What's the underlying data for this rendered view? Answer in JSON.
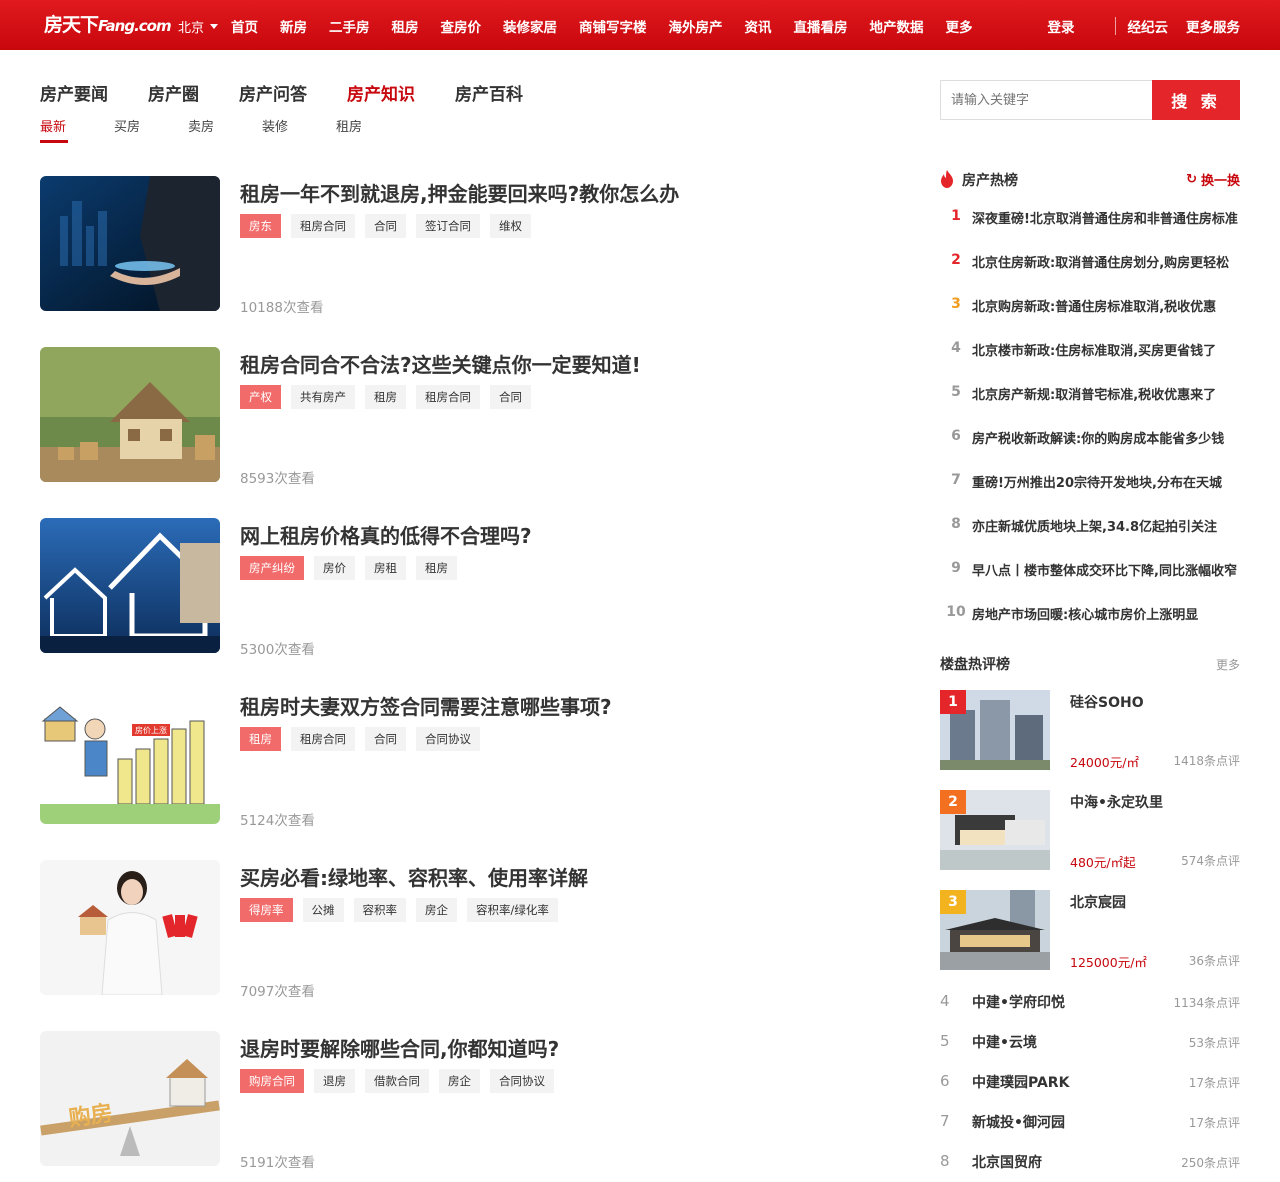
{
  "header": {
    "logo_cn": "房天下",
    "logo_en": "Fang.com",
    "city": "北京",
    "nav": [
      "首页",
      "新房",
      "二手房",
      "租房",
      "查房价",
      "装修家居",
      "商铺写字楼",
      "海外房产",
      "资讯",
      "直播看房",
      "地产数据",
      "更多"
    ],
    "login": "登录",
    "broker": "经纪云",
    "more_services": "更多服务"
  },
  "tabs": [
    "房产要闻",
    "房产圈",
    "房产问答",
    "房产知识",
    "房产百科"
  ],
  "subtabs": [
    "最新",
    "买房",
    "卖房",
    "装修",
    "租房"
  ],
  "search": {
    "placeholder": "请输入关键字",
    "button": "搜 索"
  },
  "articles": [
    {
      "title": "租房一年不到就退房,押金能要回来吗?教你怎么办",
      "tags": [
        "房东",
        "租房合同",
        "合同",
        "签订合同",
        "维权"
      ],
      "views": "10188次查看"
    },
    {
      "title": "租房合同合不合法?这些关键点你一定要知道!",
      "tags": [
        "产权",
        "共有房产",
        "租房",
        "租房合同",
        "合同"
      ],
      "views": "8593次查看"
    },
    {
      "title": "网上租房价格真的低得不合理吗?",
      "tags": [
        "房产纠纷",
        "房价",
        "房租",
        "租房"
      ],
      "views": "5300次查看"
    },
    {
      "title": "租房时夫妻双方签合同需要注意哪些事项?",
      "tags": [
        "租房",
        "租房合同",
        "合同",
        "合同协议"
      ],
      "views": "5124次查看"
    },
    {
      "title": "买房必看:绿地率、容积率、使用率详解",
      "tags": [
        "得房率",
        "公摊",
        "容积率",
        "房企",
        "容积率/绿化率"
      ],
      "views": "7097次查看"
    },
    {
      "title": "退房时要解除哪些合同,你都知道吗?",
      "tags": [
        "购房合同",
        "退房",
        "借款合同",
        "房企",
        "合同协议"
      ],
      "views": "5191次查看"
    }
  ],
  "thumb_texts": {
    "a4_sign": "房价上涨",
    "a6_word": "购房"
  },
  "hot": {
    "title": "房产热榜",
    "swap": "换一换",
    "items": [
      "深夜重磅!北京取消普通住房和非普通住房标准",
      "北京住房新政:取消普通住房划分,购房更轻松",
      "北京购房新政:普通住房标准取消,税收优惠",
      "北京楼市新政:住房标准取消,买房更省钱了",
      "北京房产新规:取消普宅标准,税收优惠来了",
      "房产税收新政解读:你的购房成本能省多少钱",
      "重磅!万州推出20宗待开发地块,分布在天城",
      "亦庄新城优质地块上架,34.8亿起拍引关注",
      "早八点丨楼市整体成交环比下降,同比涨幅收窄",
      "房地产市场回暖:核心城市房价上涨明显"
    ]
  },
  "reviews": {
    "title": "楼盘热评榜",
    "more": "更多",
    "top": [
      {
        "rank": "1",
        "name": "硅谷SOHO",
        "price": "24000元/㎡",
        "count": "1418条点评"
      },
      {
        "rank": "2",
        "name": "中海•永定玖里",
        "price": "480元/㎡起",
        "count": "574条点评"
      },
      {
        "rank": "3",
        "name": "北京宸园",
        "price": "125000元/㎡",
        "count": "36条点评"
      }
    ],
    "rest": [
      {
        "rank": "4",
        "name": "中建•学府印悦",
        "count": "1134条点评"
      },
      {
        "rank": "5",
        "name": "中建•云境",
        "count": "53条点评"
      },
      {
        "rank": "6",
        "name": "中建璞园PARK",
        "count": "17条点评"
      },
      {
        "rank": "7",
        "name": "新城投•御河园",
        "count": "17条点评"
      },
      {
        "rank": "8",
        "name": "北京国贸府",
        "count": "250条点评"
      }
    ]
  },
  "colors": {
    "brand": "#e01a1f",
    "accent": "#c7080e",
    "rank1": "#e4252a",
    "rank2": "#f37021",
    "rank3": "#f2b31f"
  }
}
